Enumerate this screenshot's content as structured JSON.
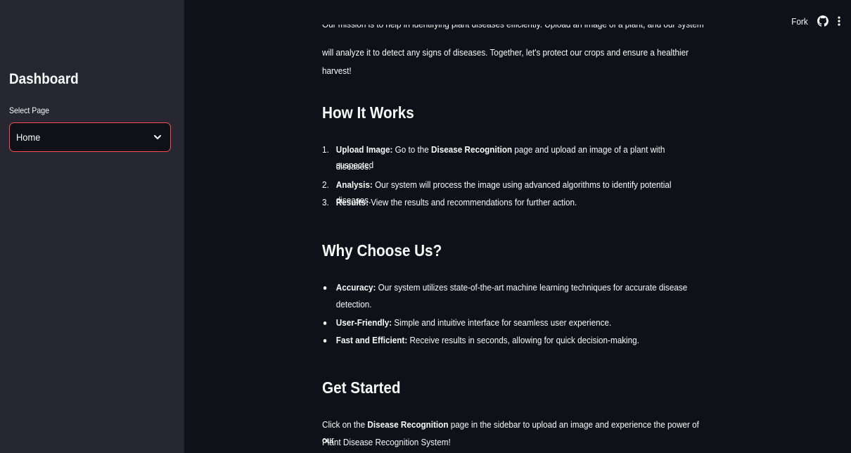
{
  "sidebar": {
    "title": "Dashboard",
    "select_label": "Select Page",
    "select_value": "Home"
  },
  "toolbar": {
    "fork_label": "Fork",
    "github_icon": "github-icon",
    "menu_icon": "kebab-menu-icon"
  },
  "content": {
    "cut_line": "Our mission is to help in identifying plant diseases efficiently. Upload an image of a plant, and our system",
    "intro_line1": "will analyze it to detect any signs of diseases. Together, let's protect our crops and ensure a healthier",
    "intro_line2": "harvest!",
    "how_heading": "How It Works",
    "how_items": [
      {
        "num": "1.",
        "bold": "Upload Image:",
        "pre": " Go to the ",
        "bold2": "Disease Recognition",
        "post": " page and upload an image of a plant with suspected",
        "cont": "diseases."
      },
      {
        "num": "2.",
        "bold": "Analysis:",
        "text": " Our system will process the image using advanced algorithms to identify potential diseases."
      },
      {
        "num": "3.",
        "bold": "Results:",
        "text": " View the results and recommendations for further action."
      }
    ],
    "why_heading": "Why Choose Us?",
    "why_items": [
      {
        "bold": "Accuracy:",
        "text": " Our system utilizes state-of-the-art machine learning techniques for accurate disease",
        "cont": "detection."
      },
      {
        "bold": "User-Friendly:",
        "text": " Simple and intuitive interface for seamless user experience."
      },
      {
        "bold": "Fast and Efficient:",
        "text": " Receive results in seconds, allowing for quick decision-making."
      }
    ],
    "start_heading": "Get Started",
    "start_pre": "Click on the ",
    "start_bold": "Disease Recognition",
    "start_post": " page in the sidebar to upload an image and experience the power of our",
    "start_line2": "Plant Disease Recognition System!"
  },
  "colors": {
    "background": "#0e1117",
    "sidebar": "#262730",
    "accent": "#ff4b4b",
    "text": "#fafafa"
  }
}
